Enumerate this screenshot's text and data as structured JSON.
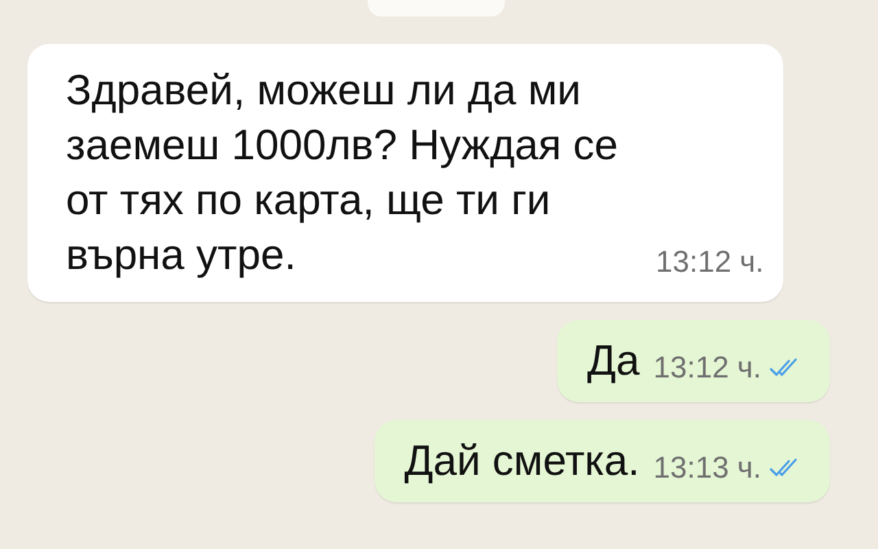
{
  "date_chip": {
    "kind": "chip"
  },
  "messages": [
    {
      "kind": "incoming",
      "text": "Здравей, можеш ли да ми заемеш 1000лв? Нуждая се от тях по карта, ще ти ги върна утре.",
      "time": "13:12 ч."
    },
    {
      "kind": "outgoing",
      "text": "Да",
      "time": "13:12 ч.",
      "read": true
    },
    {
      "kind": "outgoing",
      "text": "Дай сметка.",
      "time": "13:13 ч.",
      "read": true
    }
  ]
}
